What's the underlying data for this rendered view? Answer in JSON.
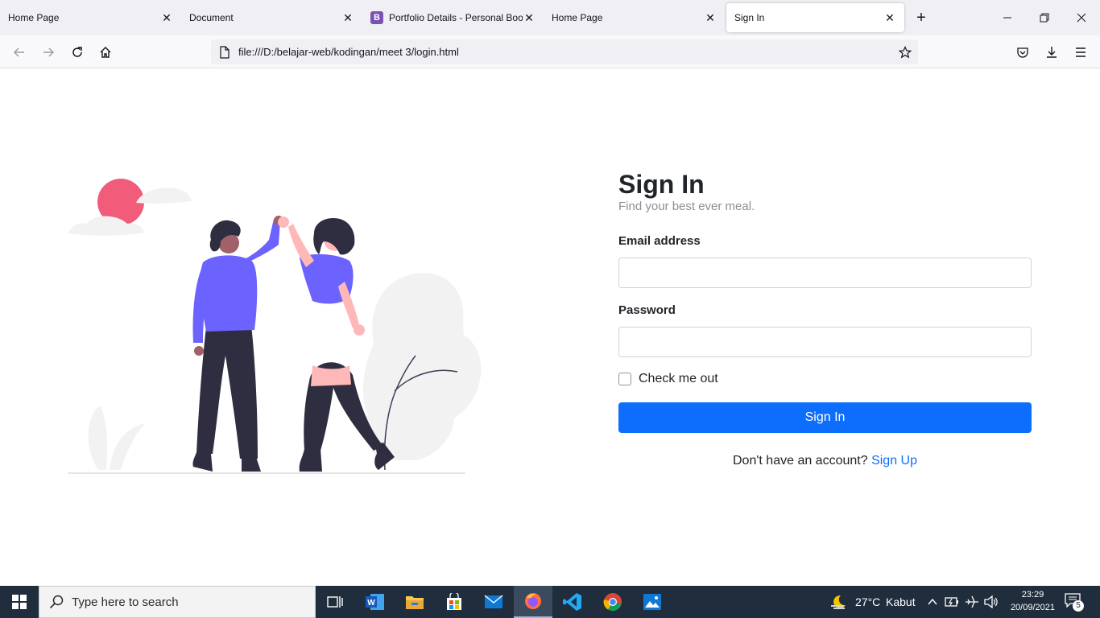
{
  "browser": {
    "tabs": [
      {
        "title": "Home Page",
        "active": false
      },
      {
        "title": "Document",
        "active": false
      },
      {
        "title": "Portfolio Details - Personal Boot",
        "active": false,
        "favicon": "B"
      },
      {
        "title": "Home Page",
        "active": false
      },
      {
        "title": "Sign In",
        "active": true
      }
    ],
    "url": "file:///D:/belajar-web/kodingan/meet 3/login.html"
  },
  "login": {
    "title": "Sign In",
    "subtitle": "Find your best ever meal.",
    "email_label": "Email address",
    "password_label": "Password",
    "remember_label": "Check me out",
    "submit_label": "Sign In",
    "signup_prompt": "Don't have an account?",
    "signup_link": "Sign Up"
  },
  "illustration": {
    "sun_color": "#f05c79",
    "shirt_color": "#6c63ff",
    "hair_color": "#2f2e41",
    "skin_color": "#a0616a",
    "foliage_color": "#f2f2f2"
  },
  "taskbar": {
    "search_placeholder": "Type here to search",
    "weather_temp": "27°C",
    "weather_desc": "Kabut",
    "time": "23:29",
    "date": "20/09/2021",
    "notification_count": "5"
  },
  "colors": {
    "primary": "#0d6efd",
    "tabstrip_bg": "#f0f0f4",
    "taskbar_bg": "#1f2d3d"
  }
}
